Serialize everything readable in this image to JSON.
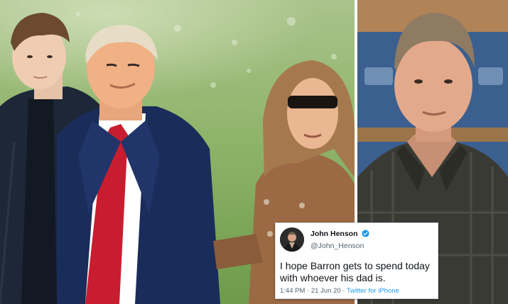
{
  "tweet": {
    "name": "John Henson",
    "handle": "@John_Henson",
    "text": "I hope Barron gets to spend today with whoever his dad is.",
    "time": "1:44 PM",
    "date": "21 Jun 20",
    "source": "Twitter for iPhone",
    "separator": "·",
    "verified": true,
    "colors": {
      "verified": "#1d9bf0",
      "link": "#1d9bf0"
    }
  },
  "icons": [
    "verified-badge-icon",
    "avatar"
  ]
}
